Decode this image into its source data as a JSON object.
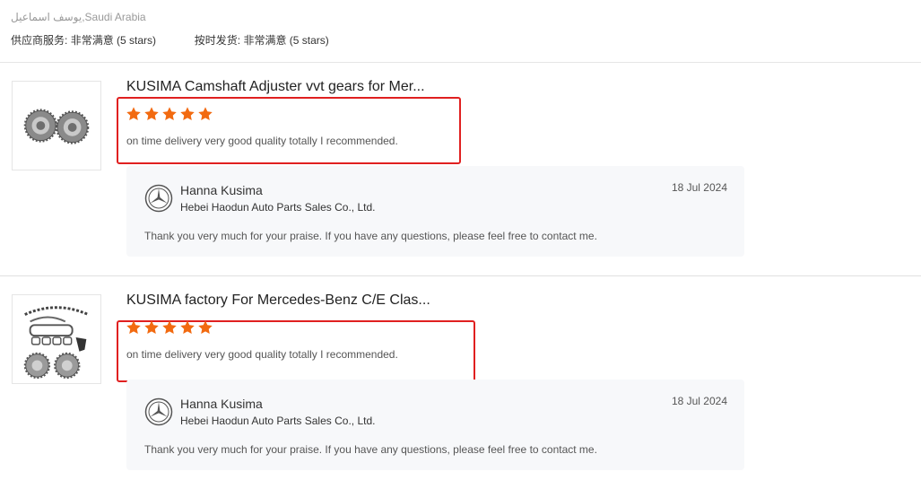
{
  "reviewer": {
    "name": "يوسف اسماعيل",
    "country": "Saudi Arabia"
  },
  "ratings": {
    "supplier_service_label": "供应商服务:",
    "supplier_service_value": "非常满意",
    "supplier_service_stars": "(5 stars)",
    "ontime_label": "按时发货:",
    "ontime_value": "非常满意",
    "ontime_stars": "(5 stars)"
  },
  "colors": {
    "star": "#f26a10",
    "highlight": "#e02020",
    "reply_bg": "#f7f8fa"
  },
  "reviews": [
    {
      "product_title": "KUSIMA Camshaft Adjuster vvt gears for Mer...",
      "rating": 5,
      "comment": "on time delivery very good quality totally I recommended.",
      "thumb_icon": "camshaft-gears-image",
      "reply": {
        "seller_name": "Hanna Kusima",
        "company": "Hebei Haodun Auto Parts Sales Co., Ltd.",
        "date": "18 Jul 2024",
        "text": "Thank you very much for your praise. If you have any questions, please feel free to contact me."
      }
    },
    {
      "product_title": "KUSIMA factory For Mercedes-Benz C/E Clas...",
      "rating": 5,
      "comment": "on time delivery very good quality totally I recommended.",
      "thumb_icon": "timing-chain-kit-image",
      "reply": {
        "seller_name": "Hanna Kusima",
        "company": "Hebei Haodun Auto Parts Sales Co., Ltd.",
        "date": "18 Jul 2024",
        "text": "Thank you very much for your praise. If you have any questions, please feel free to contact me."
      }
    }
  ]
}
